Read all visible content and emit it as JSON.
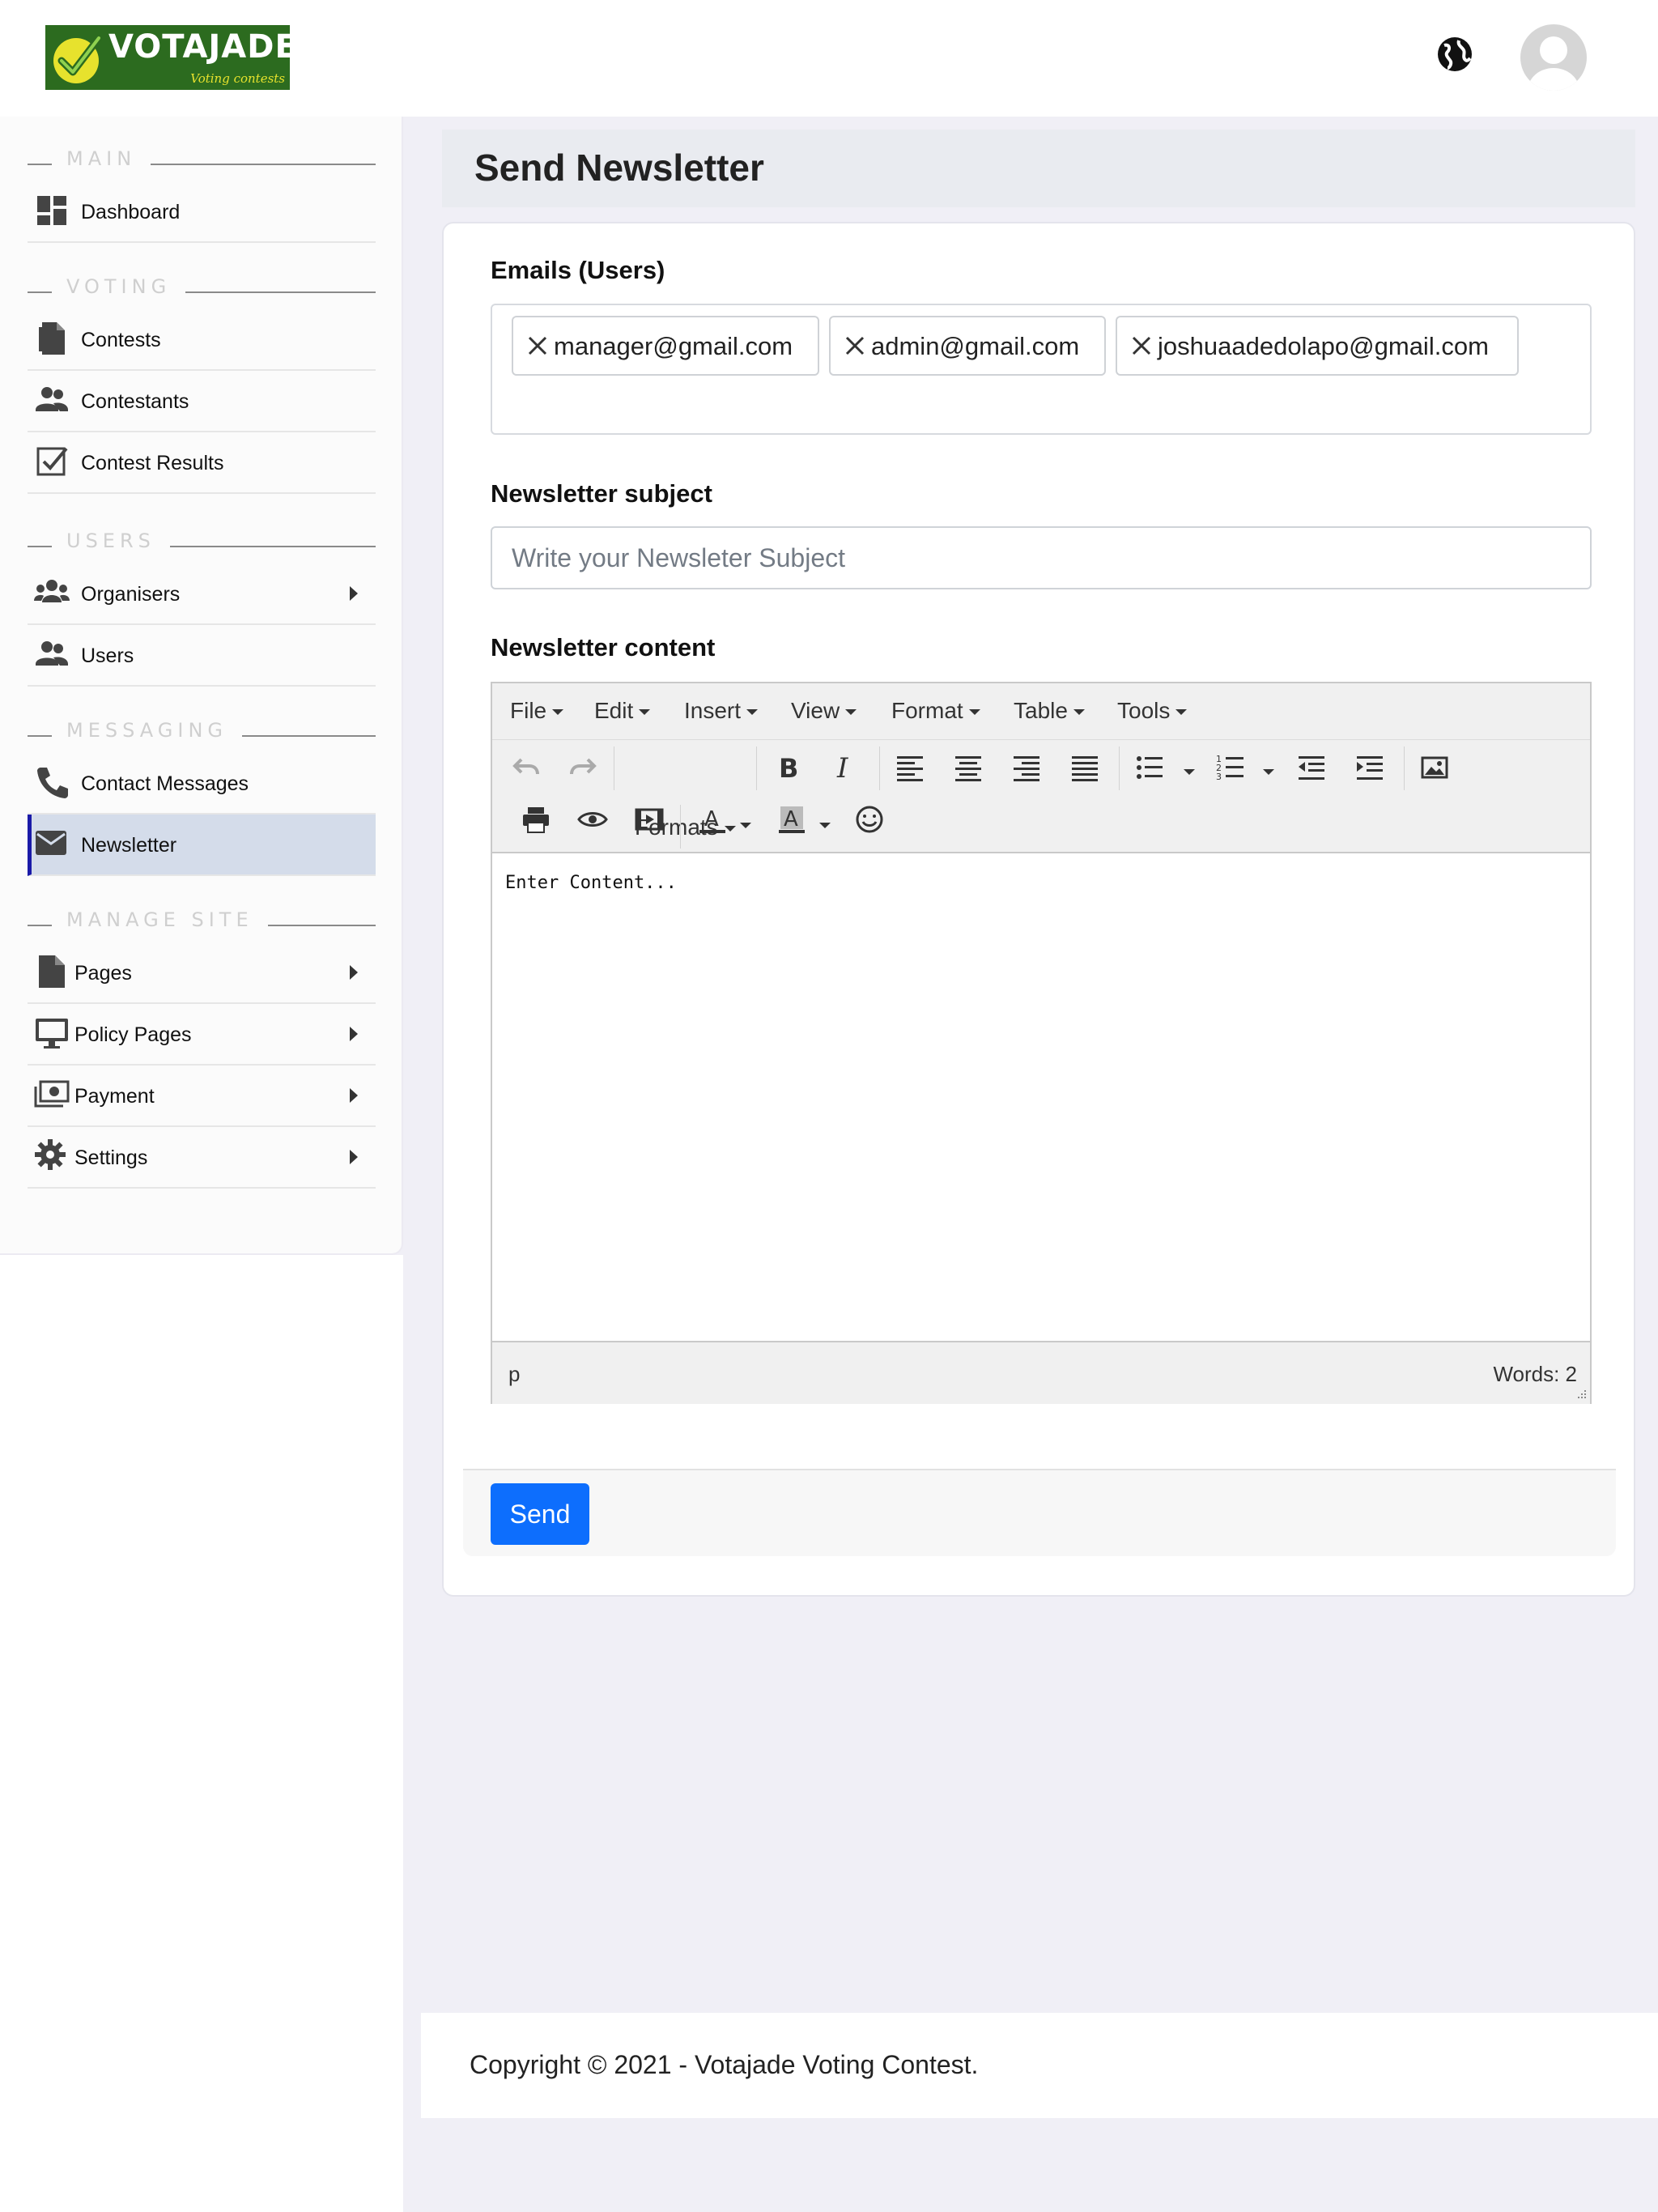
{
  "header": {
    "logo_text": "VOTAJADE",
    "logo_tagline": "Voting contests",
    "icons": [
      "globe-icon",
      "user-avatar-icon"
    ]
  },
  "sidebar": {
    "sections": [
      {
        "label": "MAIN",
        "items": [
          {
            "label": "Dashboard",
            "icon": "dashboard-icon"
          }
        ]
      },
      {
        "label": "VOTING",
        "items": [
          {
            "label": "Contests",
            "icon": "file-icon"
          },
          {
            "label": "Contestants",
            "icon": "people-icon"
          },
          {
            "label": "Contest Results",
            "icon": "checkbox-icon"
          }
        ]
      },
      {
        "label": "USERS",
        "items": [
          {
            "label": "Organisers",
            "icon": "group-icon",
            "has_submenu": true
          },
          {
            "label": "Users",
            "icon": "people-icon"
          }
        ]
      },
      {
        "label": "MESSAGING",
        "items": [
          {
            "label": "Contact Messages",
            "icon": "phone-icon"
          },
          {
            "label": "Newsletter",
            "icon": "envelope-icon",
            "active": true
          }
        ]
      },
      {
        "label": "MANAGE SITE",
        "items": [
          {
            "label": "Pages",
            "icon": "file-icon",
            "has_submenu": true
          },
          {
            "label": "Policy Pages",
            "icon": "monitor-icon",
            "has_submenu": true
          },
          {
            "label": "Payment",
            "icon": "money-icon",
            "has_submenu": true
          },
          {
            "label": "Settings",
            "icon": "gear-icon",
            "has_submenu": true
          }
        ]
      }
    ]
  },
  "page": {
    "title": "Send Newsletter"
  },
  "form": {
    "emails_label": "Emails (Users)",
    "emails": [
      "manager@gmail.com",
      "admin@gmail.com",
      "joshuaadedolapo@gmail.com"
    ],
    "subject_label": "Newsletter subject",
    "subject_placeholder": "Write your Newsleter Subject",
    "subject_value": "",
    "content_label": "Newsletter content",
    "send_label": "Send"
  },
  "editor": {
    "menu": [
      "File",
      "Edit",
      "Insert",
      "View",
      "Format",
      "Table",
      "Tools"
    ],
    "formats_label": "Formats",
    "content": "Enter Content...",
    "path": "p",
    "word_count": "Words: 2"
  },
  "footer": {
    "copyright": "Copyright © 2021 - Votajade Voting Contest."
  },
  "colors": {
    "accent": "#0d6efd",
    "active_bg": "#d4dcea",
    "active_border": "#1a1aa8",
    "logo_bg": "#2c6b1f"
  }
}
